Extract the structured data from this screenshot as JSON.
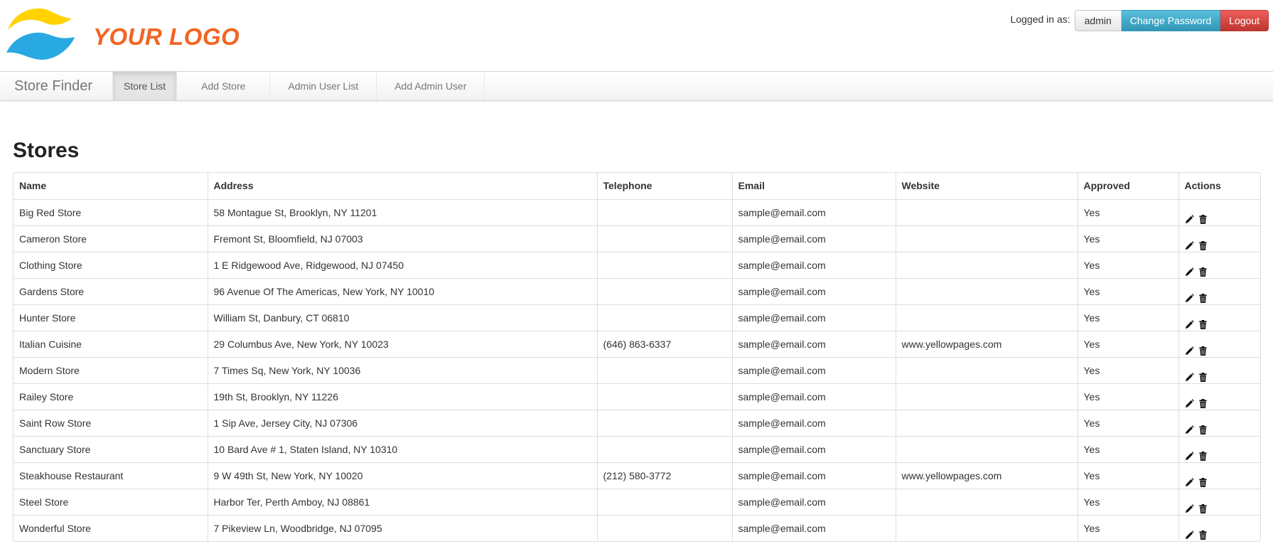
{
  "header": {
    "logo_text": "YOUR LOGO",
    "logged_in_label": "Logged in as:",
    "username": "admin",
    "change_password_label": "Change Password",
    "logout_label": "Logout"
  },
  "navbar": {
    "brand": "Store Finder",
    "items": [
      {
        "label": "Store List",
        "active": true
      },
      {
        "label": "Add Store",
        "active": false
      },
      {
        "label": "Admin User List",
        "active": false
      },
      {
        "label": "Add Admin User",
        "active": false
      }
    ]
  },
  "page": {
    "title": "Stores"
  },
  "table": {
    "columns": [
      "Name",
      "Address",
      "Telephone",
      "Email",
      "Website",
      "Approved",
      "Actions"
    ],
    "rows": [
      {
        "name": "Big Red Store",
        "address": "58 Montague St, Brooklyn, NY 11201",
        "telephone": "",
        "email": "sample@email.com",
        "website": "",
        "approved": "Yes"
      },
      {
        "name": "Cameron Store",
        "address": "Fremont St, Bloomfield, NJ 07003",
        "telephone": "",
        "email": "sample@email.com",
        "website": "",
        "approved": "Yes"
      },
      {
        "name": "Clothing Store",
        "address": "1 E Ridgewood Ave, Ridgewood, NJ 07450",
        "telephone": "",
        "email": "sample@email.com",
        "website": "",
        "approved": "Yes"
      },
      {
        "name": "Gardens Store",
        "address": "96 Avenue Of The Americas, New York, NY 10010",
        "telephone": "",
        "email": "sample@email.com",
        "website": "",
        "approved": "Yes"
      },
      {
        "name": "Hunter Store",
        "address": "William St, Danbury, CT 06810",
        "telephone": "",
        "email": "sample@email.com",
        "website": "",
        "approved": "Yes"
      },
      {
        "name": "Italian Cuisine",
        "address": "29 Columbus Ave, New York, NY 10023",
        "telephone": "(646) 863-6337",
        "email": "sample@email.com",
        "website": "www.yellowpages.com",
        "approved": "Yes"
      },
      {
        "name": "Modern Store",
        "address": "7 Times Sq, New York, NY 10036",
        "telephone": "",
        "email": "sample@email.com",
        "website": "",
        "approved": "Yes"
      },
      {
        "name": "Railey Store",
        "address": "19th St, Brooklyn, NY 11226",
        "telephone": "",
        "email": "sample@email.com",
        "website": "",
        "approved": "Yes"
      },
      {
        "name": "Saint Row Store",
        "address": "1 Sip Ave, Jersey City, NJ 07306",
        "telephone": "",
        "email": "sample@email.com",
        "website": "",
        "approved": "Yes"
      },
      {
        "name": "Sanctuary Store",
        "address": "10 Bard Ave # 1, Staten Island, NY 10310",
        "telephone": "",
        "email": "sample@email.com",
        "website": "",
        "approved": "Yes"
      },
      {
        "name": "Steakhouse Restaurant",
        "address": "9 W 49th St, New York, NY 10020",
        "telephone": "(212) 580-3772",
        "email": "sample@email.com",
        "website": "www.yellowpages.com",
        "approved": "Yes"
      },
      {
        "name": "Steel Store",
        "address": "Harbor Ter, Perth Amboy, NJ 08861",
        "telephone": "",
        "email": "sample@email.com",
        "website": "",
        "approved": "Yes"
      },
      {
        "name": "Wonderful Store",
        "address": "7 Pikeview Ln, Woodbridge, NJ 07095",
        "telephone": "",
        "email": "sample@email.com",
        "website": "",
        "approved": "Yes"
      }
    ],
    "row_actions": [
      {
        "icon": "pencil-icon",
        "purpose": "edit"
      },
      {
        "icon": "trash-icon",
        "purpose": "delete"
      }
    ]
  },
  "colors": {
    "logo_yellow": "#ffd200",
    "logo_blue": "#29a9e1",
    "logo_text_orange": "#f26522",
    "info_button": "#49afcd",
    "danger_button": "#da4f49"
  }
}
